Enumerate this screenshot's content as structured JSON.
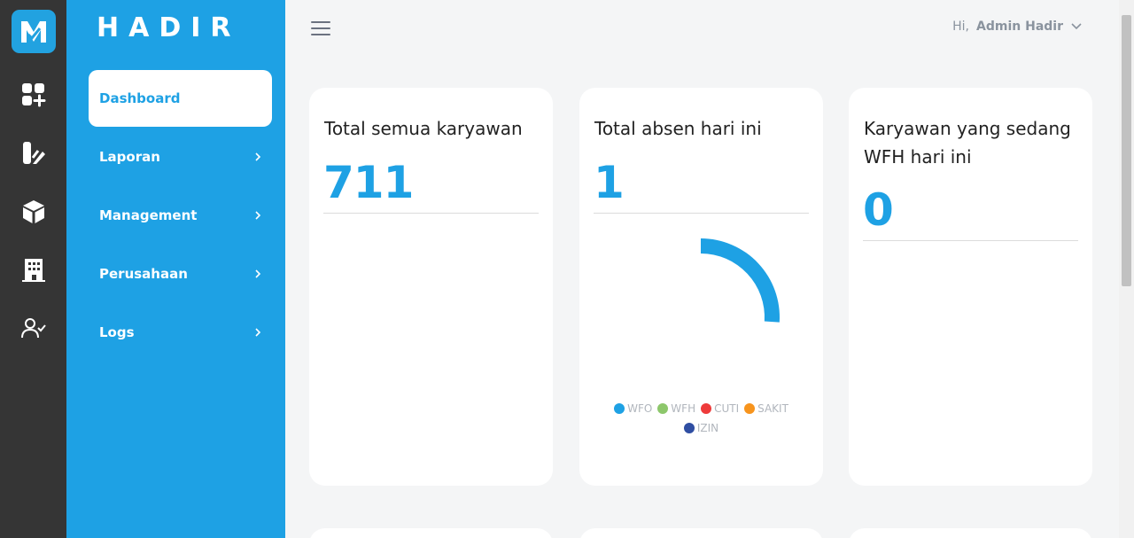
{
  "brand": "HADIR",
  "menu": {
    "items": [
      {
        "label": "Dashboard",
        "active": true
      },
      {
        "label": "Laporan"
      },
      {
        "label": "Management"
      },
      {
        "label": "Perusahaan"
      },
      {
        "label": "Logs"
      }
    ]
  },
  "header": {
    "greeting": "Hi,",
    "user_name": "Admin Hadir"
  },
  "cards": [
    {
      "title": "Total semua karyawan",
      "value": "711"
    },
    {
      "title": "Total absen hari ini",
      "value": "1"
    },
    {
      "title": "Karyawan yang sedang WFH hari ini",
      "value": "0"
    }
  ],
  "chart_data": {
    "type": "pie",
    "categories": [
      "WFO",
      "WFH",
      "CUTI",
      "SAKIT",
      "IZIN"
    ],
    "values": [
      1,
      0,
      0,
      0,
      0
    ],
    "colors": [
      "#1ea1e4",
      "#8dc76b",
      "#ee3b3b",
      "#f7941d",
      "#2f4ea2"
    ],
    "legend": "bottom"
  },
  "colors": {
    "accent": "#1ea1e4",
    "rail": "#353535"
  }
}
